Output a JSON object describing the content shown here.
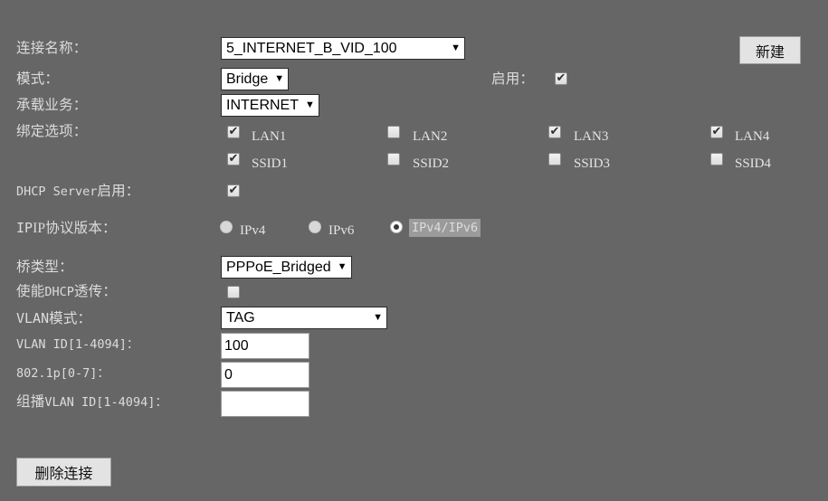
{
  "form": {
    "connection_name": {
      "label": "连接名称：",
      "value": "5_INTERNET_B_VID_100"
    },
    "mode": {
      "label": "模式：",
      "value": "Bridge"
    },
    "enable": {
      "label": "启用：",
      "checked": true
    },
    "service": {
      "label": "承载业务：",
      "value": "INTERNET"
    },
    "binding": {
      "label": "绑定选项：",
      "row1": [
        {
          "label": "LAN1",
          "checked": true
        },
        {
          "label": "LAN2",
          "checked": false
        },
        {
          "label": "LAN3",
          "checked": true
        },
        {
          "label": "LAN4",
          "checked": true
        }
      ],
      "row2": [
        {
          "label": "SSID1",
          "checked": true
        },
        {
          "label": "SSID2",
          "checked": false
        },
        {
          "label": "SSID3",
          "checked": false
        },
        {
          "label": "SSID4",
          "checked": false
        }
      ]
    },
    "dhcp_server": {
      "label_mono": "DHCP Server",
      "label_cn": "启用：",
      "checked": true
    },
    "ip_version": {
      "label": "IP协议版本：",
      "options": [
        {
          "label": "IPv4",
          "selected": false
        },
        {
          "label": "IPv6",
          "selected": false
        },
        {
          "label": "IPv4/IPv6",
          "selected": true
        }
      ]
    },
    "bridge_type": {
      "label": "桥类型：",
      "value": "PPPoE_Bridged"
    },
    "dhcp_transparent": {
      "label_cn1": "使能",
      "label_mono": "DHCP",
      "label_cn2": "透传：",
      "checked": false
    },
    "vlan_mode": {
      "label_mono": "VLAN",
      "label_cn": "模式：",
      "value": "TAG"
    },
    "vlan_id": {
      "label_mono": "VLAN ID[1-4094]：",
      "value": "100"
    },
    "dot1p": {
      "label_mono": "802.1p[0-7]：",
      "value": "0"
    },
    "mcast_vlan_id": {
      "label_cn": "组播",
      "label_mono": "VLAN ID[1-4094]：",
      "value": ""
    }
  },
  "buttons": {
    "new": "新建",
    "delete_connection": "删除连接"
  },
  "icons": {
    "caret": "▼",
    "check": "✔"
  },
  "colors": {
    "background": "#666666",
    "label_text": "#dcdcdc",
    "field_bg": "#ffffff",
    "button_bg": "#e3e3e3",
    "selection_highlight": "#9b9b9b"
  }
}
